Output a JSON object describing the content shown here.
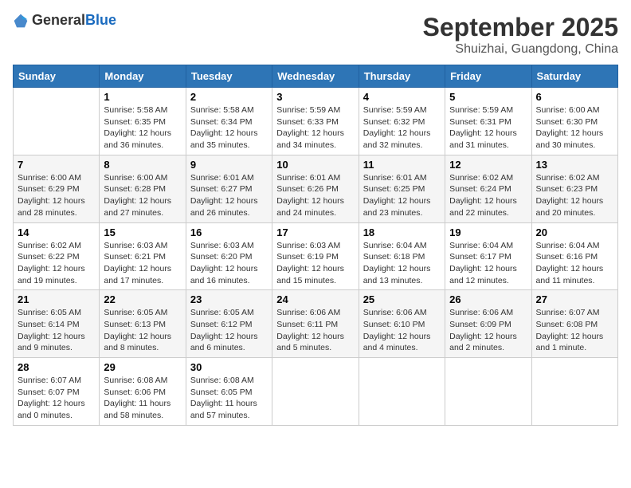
{
  "header": {
    "logo_general": "General",
    "logo_blue": "Blue",
    "title": "September 2025",
    "location": "Shuizhai, Guangdong, China"
  },
  "weekdays": [
    "Sunday",
    "Monday",
    "Tuesday",
    "Wednesday",
    "Thursday",
    "Friday",
    "Saturday"
  ],
  "weeks": [
    [
      null,
      {
        "day": "1",
        "sunrise": "5:58 AM",
        "sunset": "6:35 PM",
        "daylight": "12 hours and 36 minutes."
      },
      {
        "day": "2",
        "sunrise": "5:58 AM",
        "sunset": "6:34 PM",
        "daylight": "12 hours and 35 minutes."
      },
      {
        "day": "3",
        "sunrise": "5:59 AM",
        "sunset": "6:33 PM",
        "daylight": "12 hours and 34 minutes."
      },
      {
        "day": "4",
        "sunrise": "5:59 AM",
        "sunset": "6:32 PM",
        "daylight": "12 hours and 32 minutes."
      },
      {
        "day": "5",
        "sunrise": "5:59 AM",
        "sunset": "6:31 PM",
        "daylight": "12 hours and 31 minutes."
      },
      {
        "day": "6",
        "sunrise": "6:00 AM",
        "sunset": "6:30 PM",
        "daylight": "12 hours and 30 minutes."
      }
    ],
    [
      {
        "day": "7",
        "sunrise": "6:00 AM",
        "sunset": "6:29 PM",
        "daylight": "12 hours and 28 minutes."
      },
      {
        "day": "8",
        "sunrise": "6:00 AM",
        "sunset": "6:28 PM",
        "daylight": "12 hours and 27 minutes."
      },
      {
        "day": "9",
        "sunrise": "6:01 AM",
        "sunset": "6:27 PM",
        "daylight": "12 hours and 26 minutes."
      },
      {
        "day": "10",
        "sunrise": "6:01 AM",
        "sunset": "6:26 PM",
        "daylight": "12 hours and 24 minutes."
      },
      {
        "day": "11",
        "sunrise": "6:01 AM",
        "sunset": "6:25 PM",
        "daylight": "12 hours and 23 minutes."
      },
      {
        "day": "12",
        "sunrise": "6:02 AM",
        "sunset": "6:24 PM",
        "daylight": "12 hours and 22 minutes."
      },
      {
        "day": "13",
        "sunrise": "6:02 AM",
        "sunset": "6:23 PM",
        "daylight": "12 hours and 20 minutes."
      }
    ],
    [
      {
        "day": "14",
        "sunrise": "6:02 AM",
        "sunset": "6:22 PM",
        "daylight": "12 hours and 19 minutes."
      },
      {
        "day": "15",
        "sunrise": "6:03 AM",
        "sunset": "6:21 PM",
        "daylight": "12 hours and 17 minutes."
      },
      {
        "day": "16",
        "sunrise": "6:03 AM",
        "sunset": "6:20 PM",
        "daylight": "12 hours and 16 minutes."
      },
      {
        "day": "17",
        "sunrise": "6:03 AM",
        "sunset": "6:19 PM",
        "daylight": "12 hours and 15 minutes."
      },
      {
        "day": "18",
        "sunrise": "6:04 AM",
        "sunset": "6:18 PM",
        "daylight": "12 hours and 13 minutes."
      },
      {
        "day": "19",
        "sunrise": "6:04 AM",
        "sunset": "6:17 PM",
        "daylight": "12 hours and 12 minutes."
      },
      {
        "day": "20",
        "sunrise": "6:04 AM",
        "sunset": "6:16 PM",
        "daylight": "12 hours and 11 minutes."
      }
    ],
    [
      {
        "day": "21",
        "sunrise": "6:05 AM",
        "sunset": "6:14 PM",
        "daylight": "12 hours and 9 minutes."
      },
      {
        "day": "22",
        "sunrise": "6:05 AM",
        "sunset": "6:13 PM",
        "daylight": "12 hours and 8 minutes."
      },
      {
        "day": "23",
        "sunrise": "6:05 AM",
        "sunset": "6:12 PM",
        "daylight": "12 hours and 6 minutes."
      },
      {
        "day": "24",
        "sunrise": "6:06 AM",
        "sunset": "6:11 PM",
        "daylight": "12 hours and 5 minutes."
      },
      {
        "day": "25",
        "sunrise": "6:06 AM",
        "sunset": "6:10 PM",
        "daylight": "12 hours and 4 minutes."
      },
      {
        "day": "26",
        "sunrise": "6:06 AM",
        "sunset": "6:09 PM",
        "daylight": "12 hours and 2 minutes."
      },
      {
        "day": "27",
        "sunrise": "6:07 AM",
        "sunset": "6:08 PM",
        "daylight": "12 hours and 1 minute."
      }
    ],
    [
      {
        "day": "28",
        "sunrise": "6:07 AM",
        "sunset": "6:07 PM",
        "daylight": "12 hours and 0 minutes."
      },
      {
        "day": "29",
        "sunrise": "6:08 AM",
        "sunset": "6:06 PM",
        "daylight": "11 hours and 58 minutes."
      },
      {
        "day": "30",
        "sunrise": "6:08 AM",
        "sunset": "6:05 PM",
        "daylight": "11 hours and 57 minutes."
      },
      null,
      null,
      null,
      null
    ]
  ]
}
